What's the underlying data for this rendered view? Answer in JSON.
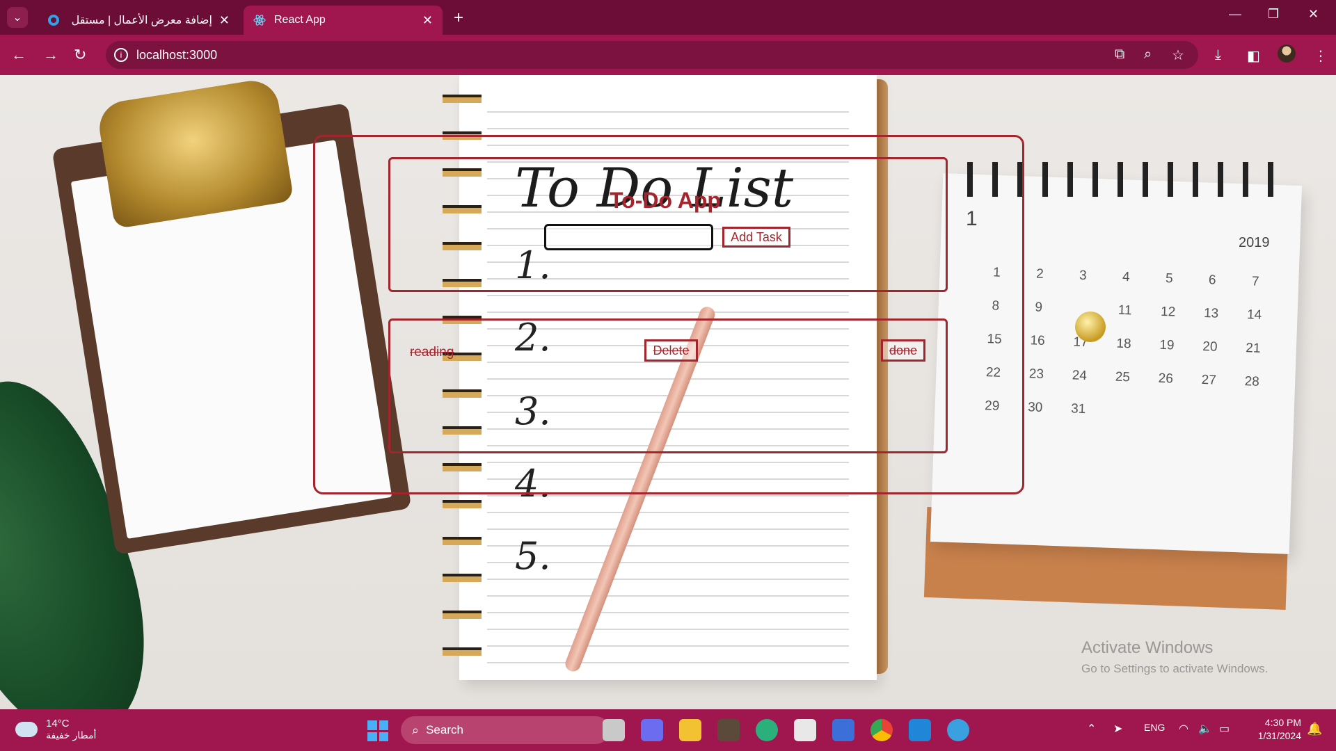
{
  "browser": {
    "tabs": [
      {
        "title": "إضافة معرض الأعمال | مستقل",
        "active": false
      },
      {
        "title": "React App",
        "active": true
      }
    ],
    "url": "localhost:3000"
  },
  "background": {
    "handwritten_title": "To Do List",
    "numbers": [
      "1.",
      "2.",
      "3.",
      "4.",
      "5."
    ],
    "calendar_year": "2019",
    "calendar_month": "1",
    "calendar_days": [
      "1",
      "2",
      "3",
      "4",
      "5",
      "6",
      "7",
      "8",
      "9",
      "",
      "11",
      "12",
      "13",
      "14",
      "15",
      "16",
      "17",
      "18",
      "19",
      "20",
      "21",
      "22",
      "23",
      "24",
      "25",
      "26",
      "27",
      "28",
      "29",
      "30",
      "31"
    ]
  },
  "app": {
    "title": "To-Do App",
    "input_value": "",
    "add_button": "Add Task",
    "tasks": [
      {
        "text": "reading",
        "done": true,
        "delete_label": "Delete",
        "done_label": "done"
      }
    ],
    "colors": {
      "accent": "#a3262e"
    }
  },
  "watermark": {
    "line1": "Activate Windows",
    "line2": "Go to Settings to activate Windows."
  },
  "taskbar": {
    "weather_temp": "14°C",
    "weather_cond": "أمطار خفيفة",
    "search_label": "Search",
    "language": "ENG",
    "time": "4:30 PM",
    "date": "1/31/2024"
  }
}
